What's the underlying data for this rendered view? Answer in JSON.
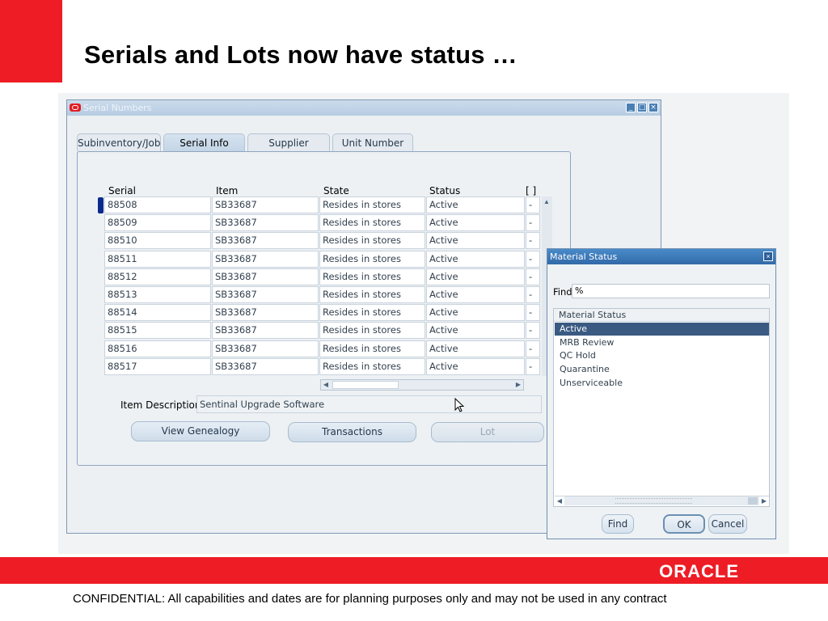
{
  "slide": {
    "title": "Serials and Lots now have status …",
    "confidential": "CONFIDENTIAL:  All capabilities and dates are for planning purposes only and may not be used in any contract",
    "logo": "ORACLE",
    "brand_red": "#ee1c25"
  },
  "window": {
    "title": "Serial Numbers",
    "controls": [
      "minimize-icon",
      "maximize-icon",
      "close-icon"
    ]
  },
  "tabs": [
    {
      "label": "Subinventory/Job",
      "active": false
    },
    {
      "label": "Serial Info",
      "active": true
    },
    {
      "label": "Supplier",
      "active": false
    },
    {
      "label": "Unit Number",
      "active": false
    }
  ],
  "table": {
    "columns": [
      "Serial",
      "Item",
      "State",
      "Status",
      "[ ]"
    ],
    "rows": [
      {
        "serial": "88508",
        "item": "SB33687",
        "state": "Resides in stores",
        "status": "Active",
        "flag": "-"
      },
      {
        "serial": "88509",
        "item": "SB33687",
        "state": "Resides in stores",
        "status": "Active",
        "flag": "-"
      },
      {
        "serial": "88510",
        "item": "SB33687",
        "state": "Resides in stores",
        "status": "Active",
        "flag": "-"
      },
      {
        "serial": "88511",
        "item": "SB33687",
        "state": "Resides in stores",
        "status": "Active",
        "flag": "-"
      },
      {
        "serial": "88512",
        "item": "SB33687",
        "state": "Resides in stores",
        "status": "Active",
        "flag": "-"
      },
      {
        "serial": "88513",
        "item": "SB33687",
        "state": "Resides in stores",
        "status": "Active",
        "flag": "-"
      },
      {
        "serial": "88514",
        "item": "SB33687",
        "state": "Resides in stores",
        "status": "Active",
        "flag": "-"
      },
      {
        "serial": "88515",
        "item": "SB33687",
        "state": "Resides in stores",
        "status": "Active",
        "flag": "-"
      },
      {
        "serial": "88516",
        "item": "SB33687",
        "state": "Resides in stores",
        "status": "Active",
        "flag": "-"
      },
      {
        "serial": "88517",
        "item": "SB33687",
        "state": "Resides in stores",
        "status": "Active",
        "flag": "-"
      }
    ]
  },
  "item_description": {
    "label": "Item Description",
    "value": "Sentinal Upgrade Software"
  },
  "buttons": {
    "view_genealogy": "View Genealogy",
    "transactions": "Transactions",
    "lot": "Lot"
  },
  "dialog": {
    "title": "Material Status",
    "find_label": "Find",
    "find_value": "%",
    "list_header": "Material Status",
    "items": [
      {
        "label": "Active",
        "selected": true
      },
      {
        "label": "MRB Review",
        "selected": false
      },
      {
        "label": "QC Hold",
        "selected": false
      },
      {
        "label": "Quarantine",
        "selected": false
      },
      {
        "label": "Unserviceable",
        "selected": false
      }
    ],
    "buttons": {
      "find": "Find",
      "ok": "OK",
      "cancel": "Cancel"
    }
  }
}
